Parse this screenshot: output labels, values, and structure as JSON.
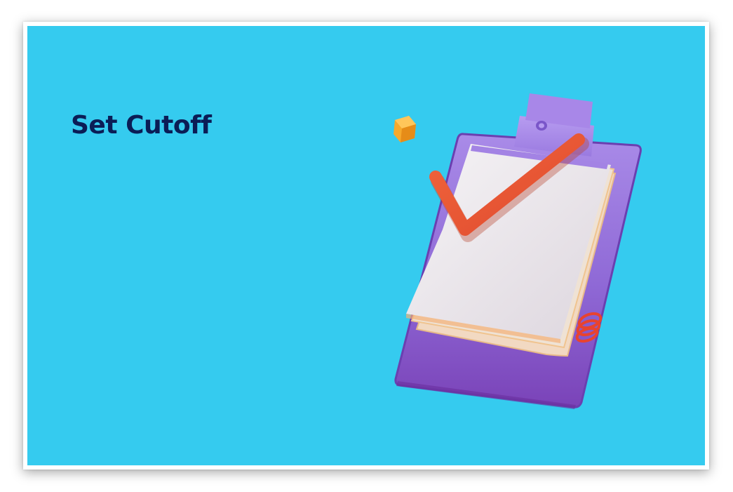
{
  "slide": {
    "title": "Set Cutoff",
    "background_color": "#35cbef",
    "title_color": "#0b1d56"
  },
  "illustration": {
    "icon": "clipboard-checklist-icon",
    "colors": {
      "clipboard": "#9b7ae0",
      "paper": "#ece8ee",
      "checkmark": "#ee5b35",
      "cube": "#f6a92c"
    }
  }
}
